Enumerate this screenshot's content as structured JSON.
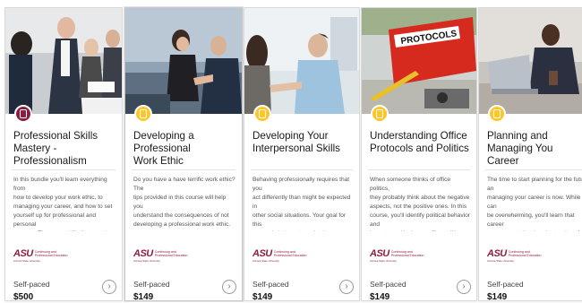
{
  "cards": [
    {
      "title": "Professional Skills Mastery -\nProfessionalism",
      "type": "bundle",
      "description": "In this bundle you'll learn everything from\nhow to develop your work ethic, to\nmanaging your career, and how to set\nyourself up for professional and personal\nsuccess. These are skills that people tend...",
      "logo_mark": "ASU",
      "logo_line1": "Continuing and",
      "logo_line2": "Professional Education",
      "logo_line3": "Arizona State University",
      "pace": "Self-paced",
      "price": "$500",
      "badge_icon": "bundle-icon",
      "arrow_icon": "chevron-right-icon"
    },
    {
      "title": "Developing a Professional\nWork Ethic",
      "type": "course",
      "description": "Do you have a have terrific work ethic? The\ntips provided in this course will help you\nunderstand the consequences of not\ndeveloping a professional work ethic.",
      "logo_mark": "ASU",
      "logo_line1": "Continuing and",
      "logo_line2": "Professional Education",
      "logo_line3": "Arizona State University",
      "pace": "Self-paced",
      "price": "$149",
      "badge_icon": "course-icon",
      "arrow_icon": "chevron-right-icon"
    },
    {
      "title": "Developing Your\nInterpersonal Skills",
      "type": "course",
      "description": "Behaving professionally requires that you\nact differently than might be expected in\nother social situations. Your goal for this\ncourse is to learn to maintain a professional\npersona.",
      "logo_mark": "ASU",
      "logo_line1": "Continuing and",
      "logo_line2": "Professional Education",
      "logo_line3": "Arizona State University",
      "pace": "Self-paced",
      "price": "$149",
      "badge_icon": "course-icon",
      "arrow_icon": "chevron-right-icon"
    },
    {
      "title": "Understanding Office\nProtocols and Politics",
      "type": "course",
      "description": "When someone thinks of office politics,\nthey probably think about the negative\naspects, not the positive ones. In this\ncourse, you'll identify political behavior and\nlearn to positively use office politics to...",
      "logo_mark": "ASU",
      "logo_line1": "Continuing and",
      "logo_line2": "Professional Education",
      "logo_line3": "Arizona State University",
      "pace": "Self-paced",
      "price": "$149",
      "badge_icon": "course-icon",
      "arrow_icon": "chevron-right-icon",
      "photo_label": "PROTOCOLS"
    },
    {
      "title": "Planning and Managing You\nCareer",
      "type": "course",
      "description": "The time to start planning for the future an\nmanaging your career is now. While it can\nbe overwhelming, you'll learn that career\nmanagement involves instructions for\nproper behavior and how to overpower...",
      "logo_mark": "ASU",
      "logo_line1": "Continuing and",
      "logo_line2": "Professional Education",
      "logo_line3": "Arizona State University",
      "pace": "Self-paced",
      "price": "$149",
      "badge_icon": "course-icon",
      "arrow_icon": "chevron-right-icon"
    }
  ],
  "colors": {
    "asu_maroon": "#8c1d40",
    "asu_gold": "#ffc627",
    "binder_red": "#d62a1e"
  }
}
